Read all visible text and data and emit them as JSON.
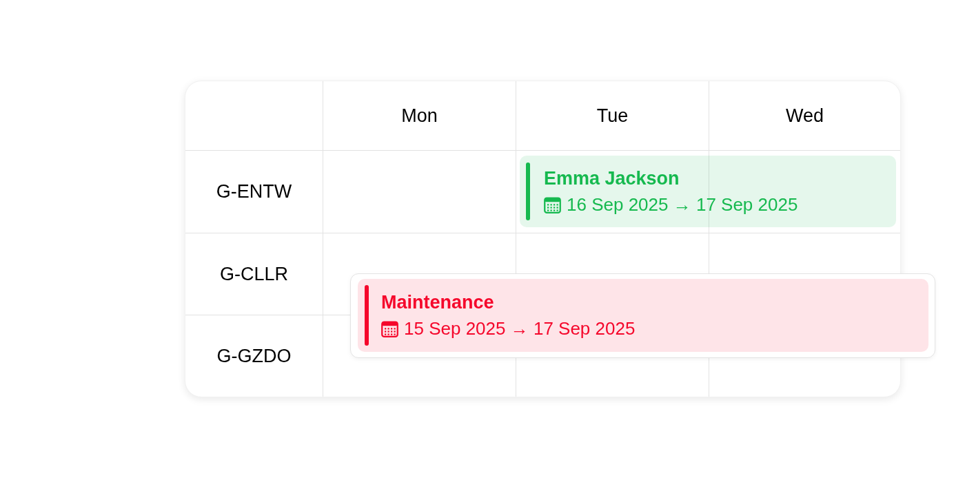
{
  "schedule": {
    "columns": [
      "Mon",
      "Tue",
      "Wed"
    ],
    "rows": [
      {
        "resource": "G-ENTW",
        "events": [
          {
            "kind": "booking",
            "title": "Emma Jackson",
            "dates": "16 Sep 2025 → 17 Sep 2025",
            "color": "#16b94f"
          }
        ]
      },
      {
        "resource": "G-CLLR"
      },
      {
        "resource": "G-GZDO"
      }
    ],
    "drag_preview": {
      "title": "Maintenance",
      "dates": "15 Sep 2025 → 17 Sep 2025",
      "color": "#f5072b"
    }
  }
}
